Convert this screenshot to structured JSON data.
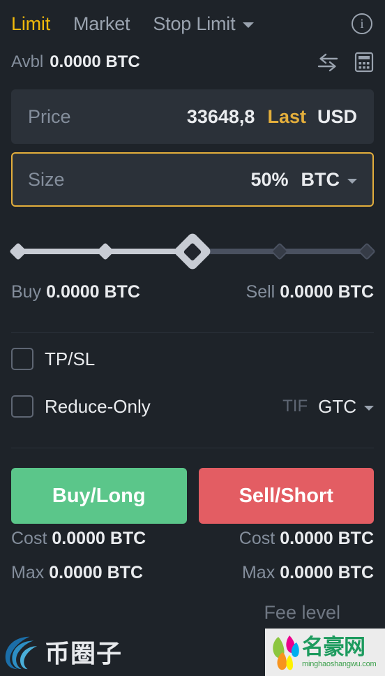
{
  "order_type_tabs": [
    {
      "label": "Limit",
      "active": true
    },
    {
      "label": "Market",
      "active": false
    },
    {
      "label": "Stop Limit",
      "active": false,
      "has_caret": true
    }
  ],
  "header": {
    "info_icon": "info-icon",
    "info_glyph": "i"
  },
  "available": {
    "label": "Avbl",
    "value": "0.0000 BTC",
    "transfer_icon": "transfer-arrows-icon",
    "calculator_icon": "calculator-icon"
  },
  "price_field": {
    "placeholder": "Price",
    "value": "33648,8",
    "tag": "Last",
    "unit": "USD"
  },
  "size_field": {
    "placeholder": "Size",
    "value": "50%",
    "unit": "BTC",
    "focused": true,
    "caret_icon": "chevron-down-icon"
  },
  "slider": {
    "percent": 50,
    "marks": [
      0,
      25,
      50,
      75,
      100
    ],
    "handle_icon": "slider-handle-diamond"
  },
  "amounts": {
    "buy_label": "Buy",
    "buy_value": "0.0000 BTC",
    "sell_label": "Sell",
    "sell_value": "0.0000 BTC"
  },
  "options": {
    "tpsl_label": "TP/SL",
    "tpsl_checked": false,
    "reduce_only_label": "Reduce-Only",
    "reduce_only_checked": false,
    "tif_label": "TIF",
    "tif_value": "GTC",
    "tif_caret_icon": "chevron-down-icon"
  },
  "actions": {
    "buy_label": "Buy/Long",
    "sell_label": "Sell/Short",
    "buy_color": "#5bc68a",
    "sell_color": "#e35d63"
  },
  "stats": {
    "buy_cost_label": "Cost",
    "buy_cost_value": "0.0000 BTC",
    "sell_cost_label": "Cost",
    "sell_cost_value": "0.0000 BTC",
    "buy_max_label": "Max",
    "buy_max_value": "0.0000 BTC",
    "sell_max_label": "Max",
    "sell_max_value": "0.0000 BTC"
  },
  "fee": {
    "label": "Fee level"
  },
  "watermarks": {
    "left_text": "币圈子",
    "right_text": "名豪网",
    "right_sub": "minghaoshangwu.com"
  },
  "colors": {
    "background": "#1e2329",
    "field_bg": "#2b3139",
    "accent_yellow": "#f0b90b",
    "focus_border": "#e3ae3c",
    "text_primary": "#eaecef",
    "text_muted": "#848e9c"
  }
}
